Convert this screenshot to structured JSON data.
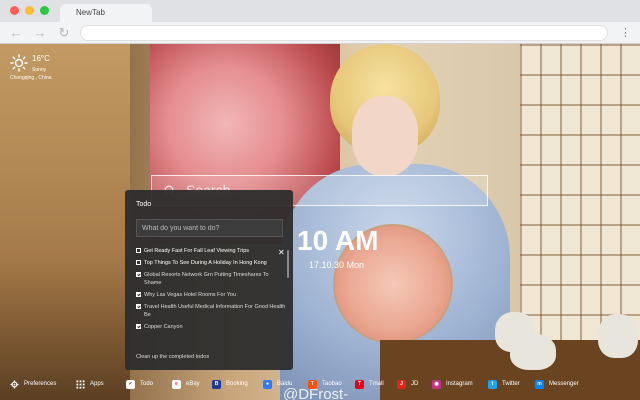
{
  "browser": {
    "tab_title": "NewTab",
    "traffic_lights": [
      "#ff5f57",
      "#febc2e",
      "#28c840"
    ],
    "back_icon": "back-arrow-icon",
    "forward_icon": "forward-arrow-icon",
    "reload_icon": "reload-icon",
    "menu_icon": "kebab-menu-icon"
  },
  "weather": {
    "icon": "sun-icon",
    "temperature": "16°C",
    "condition": "Sunny",
    "location": "Chongqing , China"
  },
  "search": {
    "icon": "search-icon",
    "placeholder": "Search"
  },
  "clock": {
    "time": "10 AM",
    "date": "17.10.30 Mon"
  },
  "todo": {
    "title": "Todo",
    "input_placeholder": "What do you want to do?",
    "items": [
      {
        "text": "Get Ready Fast For Fall Leaf Viewing Trips",
        "checked": false
      },
      {
        "text": "Top Things To See During A Holiday In Hong Kong",
        "checked": false
      },
      {
        "text": "Global Resorts Network Grn Putting Timeshares To Shame",
        "checked": true
      },
      {
        "text": "Why Las Vegas Hotel Rooms For You",
        "checked": true
      },
      {
        "text": "Travel Health Useful Medical Information For Good Health Be",
        "checked": true
      },
      {
        "text": "Copper Canyon",
        "checked": true
      }
    ],
    "close_icon": "close-icon",
    "clean_label": "Clean up the completed todos"
  },
  "bottom_bar": {
    "preferences": {
      "label": "Preferences",
      "icon": "gear-icon"
    },
    "apps": {
      "label": "Apps",
      "icon": "grid-icon"
    },
    "todo": {
      "label": "Todo",
      "icon": "checkbox-icon"
    },
    "links": [
      {
        "label": "eBay",
        "icon": "ebay-icon",
        "color": "#ffffff"
      },
      {
        "label": "Booking",
        "icon": "booking-icon",
        "color": "#1f3a93"
      },
      {
        "label": "Baidu",
        "icon": "baidu-icon",
        "color": "#2d7cf6"
      },
      {
        "label": "Taobao",
        "icon": "taobao-icon",
        "color": "#ff5000"
      },
      {
        "label": "Tmall",
        "icon": "tmall-icon",
        "color": "#e0001b"
      },
      {
        "label": "JD",
        "icon": "jd-icon",
        "color": "#e1251b"
      },
      {
        "label": "Instagram",
        "icon": "instagram-icon",
        "color": "#c13584"
      },
      {
        "label": "Twitter",
        "icon": "twitter-icon",
        "color": "#1da1f2"
      },
      {
        "label": "Messenger",
        "icon": "messenger-icon",
        "color": "#0084ff"
      }
    ]
  },
  "watermark": "@DFrost-"
}
